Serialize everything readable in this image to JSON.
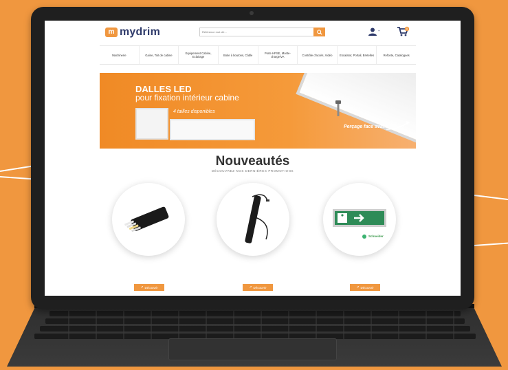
{
  "brand": {
    "logo_mark": "m",
    "logo_text": "mydrim",
    "accent": "#f0973f",
    "brand_blue": "#2f3b6b"
  },
  "search": {
    "placeholder": "Référence mot clé..."
  },
  "header": {
    "user_menu": "-",
    "cart_count": "0"
  },
  "nav": {
    "items": [
      "Machinerie",
      "Gaine, Toit de cabine",
      "Equipement Cabine, Eclairage",
      "Boite à boutons, Câble",
      "Porte HPSE, Monte-charge/VA",
      "Contrôle d'accès, Vidéo",
      "Escalator, Portail, Bretelles",
      "Refonte, Catalogues"
    ]
  },
  "banner": {
    "title": "DALLES LED",
    "subtitle": "pour fixation intérieur cabine",
    "sizes": "4 tailles disponibles",
    "note": "Perçage face avant"
  },
  "section": {
    "title": "Nouveautés",
    "subtitle": "DÉCOUVREZ NOS DERNIÈRES PROMOTIONS"
  },
  "products": [
    {
      "name": "flat-cable",
      "button": "Découvrir"
    },
    {
      "name": "led-bar",
      "button": "Découvrir"
    },
    {
      "name": "exit-sign",
      "button": "Découvrir",
      "brand": "Schneider"
    }
  ]
}
